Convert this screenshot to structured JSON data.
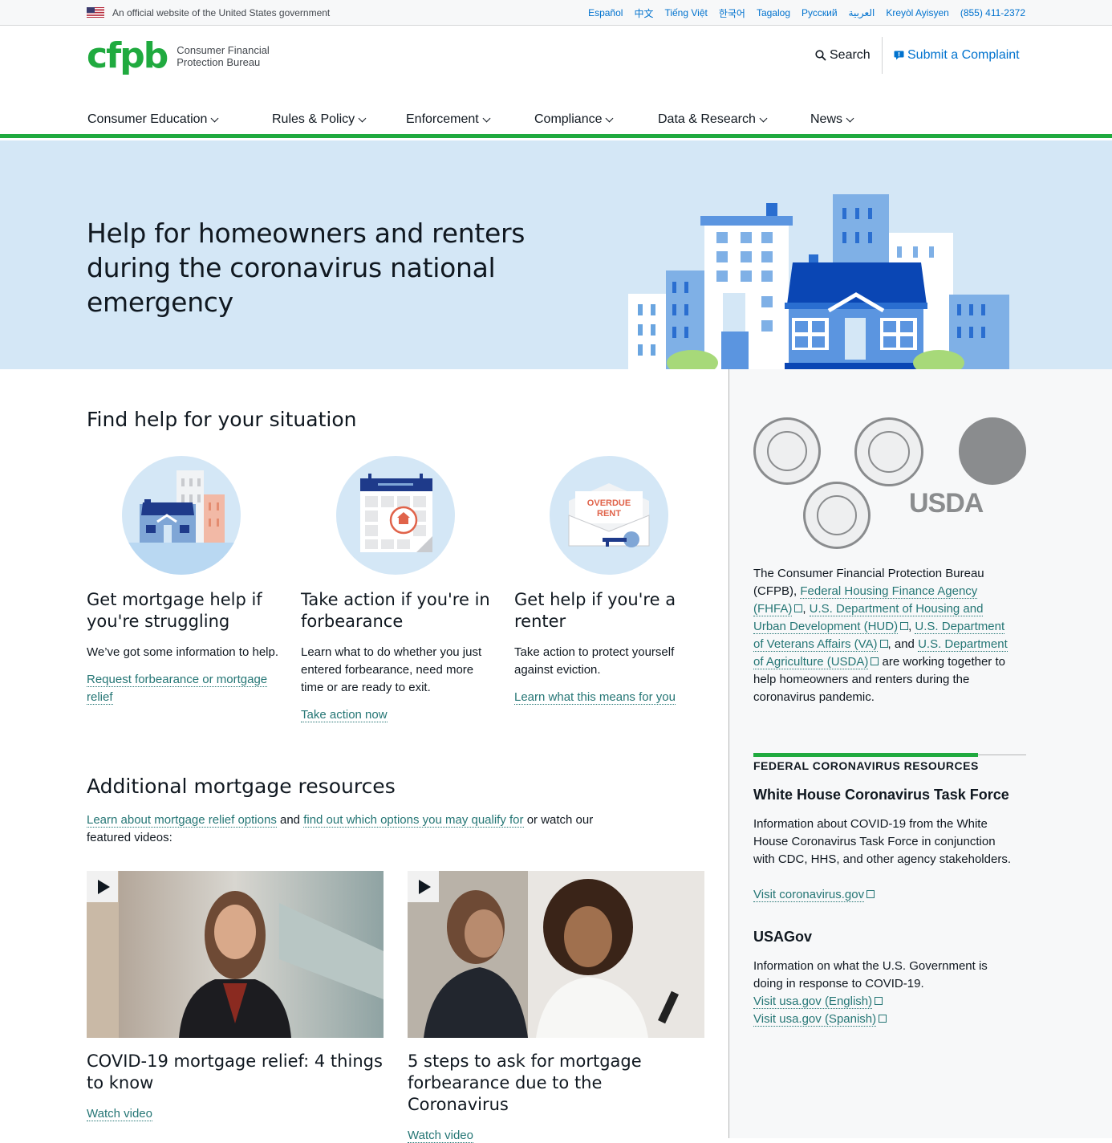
{
  "gov_banner": {
    "text": "An official website of the United States government",
    "languages": [
      "Español",
      "中文",
      "Tiếng Việt",
      "한국어",
      "Tagalog",
      "Русский",
      "العربية",
      "Kreyòl Ayisyen",
      "(855) 411-2372"
    ]
  },
  "header": {
    "logo_mark": "cfpb",
    "logo_name_1": "Consumer Financial",
    "logo_name_2": "Protection Bureau",
    "search_label": "Search",
    "complaint_label": "Submit a Complaint"
  },
  "nav": {
    "items": [
      "Consumer Education",
      "Rules & Policy",
      "Enforcement",
      "Compliance",
      "Data & Research",
      "News"
    ]
  },
  "hero": {
    "title": "Help for homeowners and renters during the coronavirus national emergency"
  },
  "situation": {
    "title": "Find help for your situation",
    "cards": [
      {
        "title": "Get mortgage help if you're struggling",
        "text": "We’ve got some information to help.",
        "link": "Request forbearance or mortgage relief"
      },
      {
        "title": "Take action if you're in forbearance",
        "text": "Learn what to do whether you just entered forbearance, need more time or are ready to exit.",
        "link": "Take action now"
      },
      {
        "title": "Get help if you're a renter",
        "text": "Take action to protect yourself against eviction.",
        "link": "Learn what this means for you"
      }
    ],
    "overdue_1": "OVERDUE",
    "overdue_2": "RENT"
  },
  "additional": {
    "title": "Additional mortgage resources",
    "link1": "Learn about mortgage relief options",
    "and": " and ",
    "link2": "find out which options you may qualify for",
    "rest": " or watch our featured videos:",
    "videos": [
      {
        "title": "COVID-19 mortgage relief: 4 things to know",
        "link": "Watch video"
      },
      {
        "title": "5 steps to ask for mortgage forbearance due to the Coronavirus",
        "link": "Watch video"
      }
    ]
  },
  "sidebar": {
    "usda": "USDA",
    "blurb_1": "The Consumer Financial Protection Bureau (CFPB), ",
    "link_fhfa": "Federal Housing Finance Agency (FHFA)",
    "comma1": ", ",
    "link_hud": "U.S. Department of Housing and Urban Development (HUD)",
    "comma2": ", ",
    "link_va": "U.S. Department of Veterans Affairs (VA)",
    "and": ", and ",
    "link_usda": "U.S. Department of Agriculture (USDA)",
    "blurb_2": " are working together to help homeowners and renters during the coronavirus pandemic.",
    "resources_heading": "FEDERAL CORONAVIRUS RESOURCES",
    "r1_title": "White House Coronavirus Task Force",
    "r1_text": "Information about COVID-19 from the White House Coronavirus Task Force in conjunction with CDC, HHS, and other agency stakeholders.",
    "r1_link": "Visit coronavirus.gov",
    "r2_title": "USAGov",
    "r2_text": "Information on what the U.S. Government is doing in response to COVID-19.",
    "r2_link1": "Visit usa.gov (English)",
    "r2_link2": "Visit usa.gov (Spanish)"
  },
  "colors": {
    "brand_green": "#20aa3f",
    "link_teal": "#257675",
    "link_blue": "#0072ce",
    "hero_bg": "#d4e7f6"
  }
}
